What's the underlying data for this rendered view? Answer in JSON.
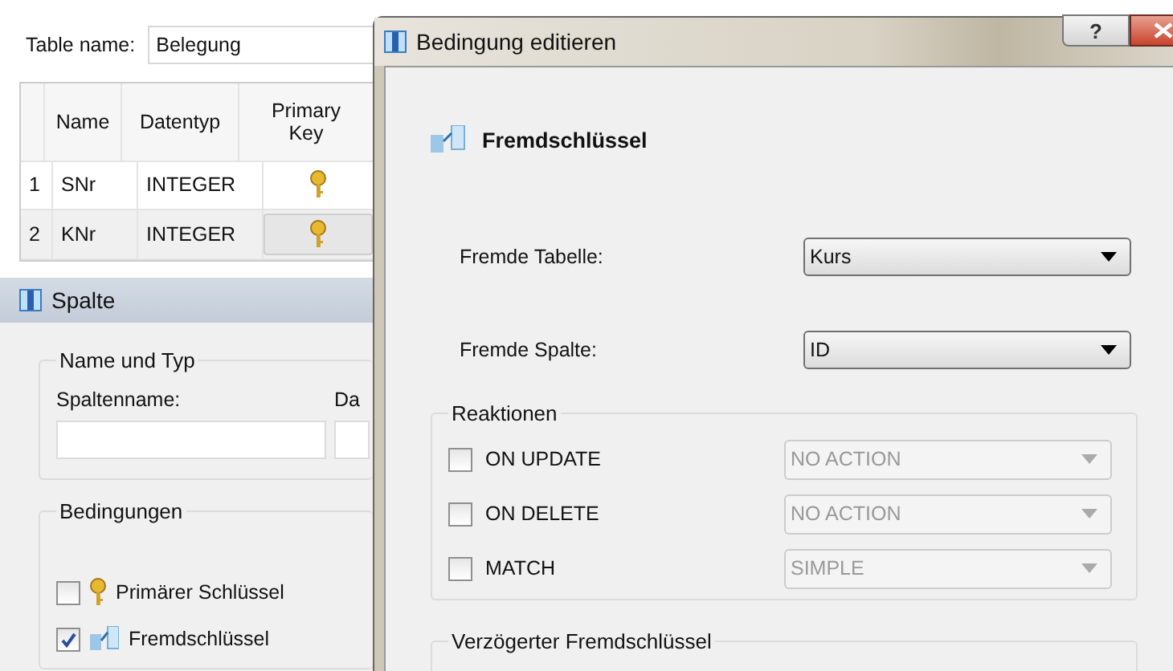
{
  "table_editor": {
    "table_name_label": "Table name:",
    "table_name": "Belegung",
    "columns": [
      "Name",
      "Datentyp",
      "Primary Key"
    ],
    "rows": [
      {
        "index": "1",
        "name": "SNr",
        "type": "INTEGER",
        "primary_key": true,
        "selected": false
      },
      {
        "index": "2",
        "name": "KNr",
        "type": "INTEGER",
        "primary_key": true,
        "selected": true
      }
    ]
  },
  "column_panel": {
    "title": "Spalte",
    "name_type_group": {
      "title": "Name und Typ",
      "column_name_label": "Spaltenname:",
      "type_label": "Da"
    },
    "constraints_group": {
      "title": "Bedingungen",
      "items": [
        {
          "kind": "primary-key",
          "label": "Primärer Schlüssel",
          "checked": false
        },
        {
          "kind": "foreign-key",
          "label": "Fremdschlüssel",
          "checked": true
        }
      ]
    }
  },
  "dialog": {
    "title": "Bedingung editieren",
    "help": "?",
    "heading": "Fremdschlüssel",
    "foreign_table_label": "Fremde Tabelle:",
    "foreign_table": "Kurs",
    "foreign_column_label": "Fremde Spalte:",
    "foreign_column": "ID",
    "reactions": {
      "title": "Reaktionen",
      "items": [
        {
          "label": "ON UPDATE",
          "checked": false,
          "value": "NO ACTION",
          "disabled": true
        },
        {
          "label": "ON DELETE",
          "checked": false,
          "value": "NO ACTION",
          "disabled": true
        },
        {
          "label": "MATCH",
          "checked": false,
          "value": "SIMPLE",
          "disabled": true
        }
      ]
    },
    "deferred_group": {
      "title": "Verzögerter Fremdschlüssel"
    }
  }
}
